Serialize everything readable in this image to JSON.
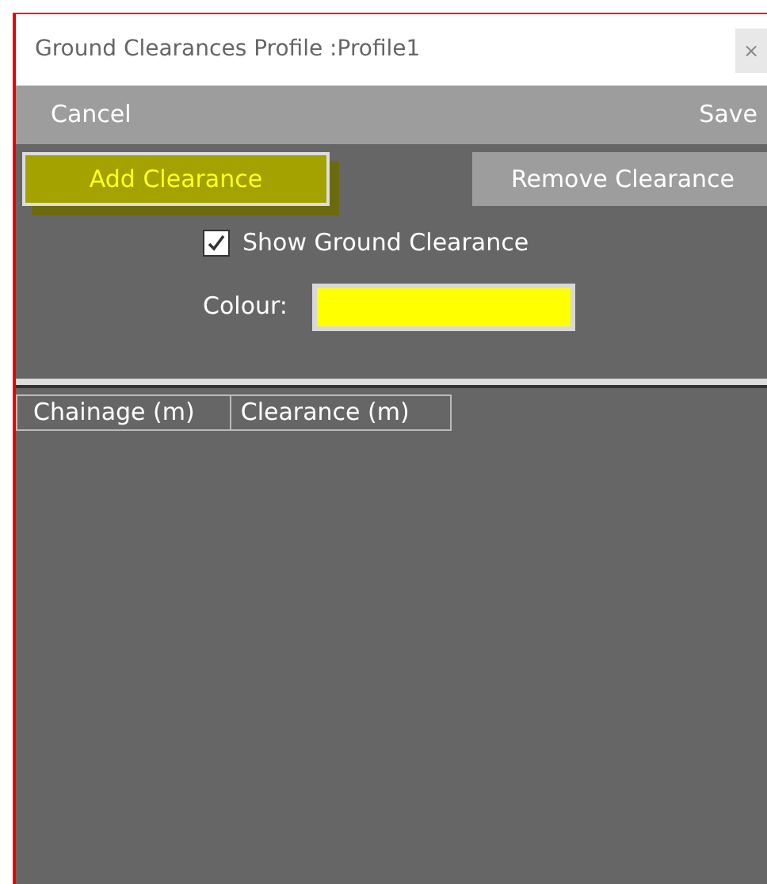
{
  "window": {
    "title": "Ground Clearances Profile :Profile1",
    "close": "×"
  },
  "toolbar": {
    "cancel": "Cancel",
    "save": "Save"
  },
  "buttons": [
    {
      "label": "Add Clearance",
      "highlighted": true
    },
    {
      "label": "Remove Clearance",
      "highlighted": false
    }
  ],
  "show_ground_clearance": {
    "label": "Show Ground Clearance",
    "checked": true
  },
  "colour": {
    "label": "Colour:",
    "color": "#ffff00"
  },
  "table": {
    "columns": [
      "Chainage (m)",
      "Clearance (m)"
    ]
  }
}
